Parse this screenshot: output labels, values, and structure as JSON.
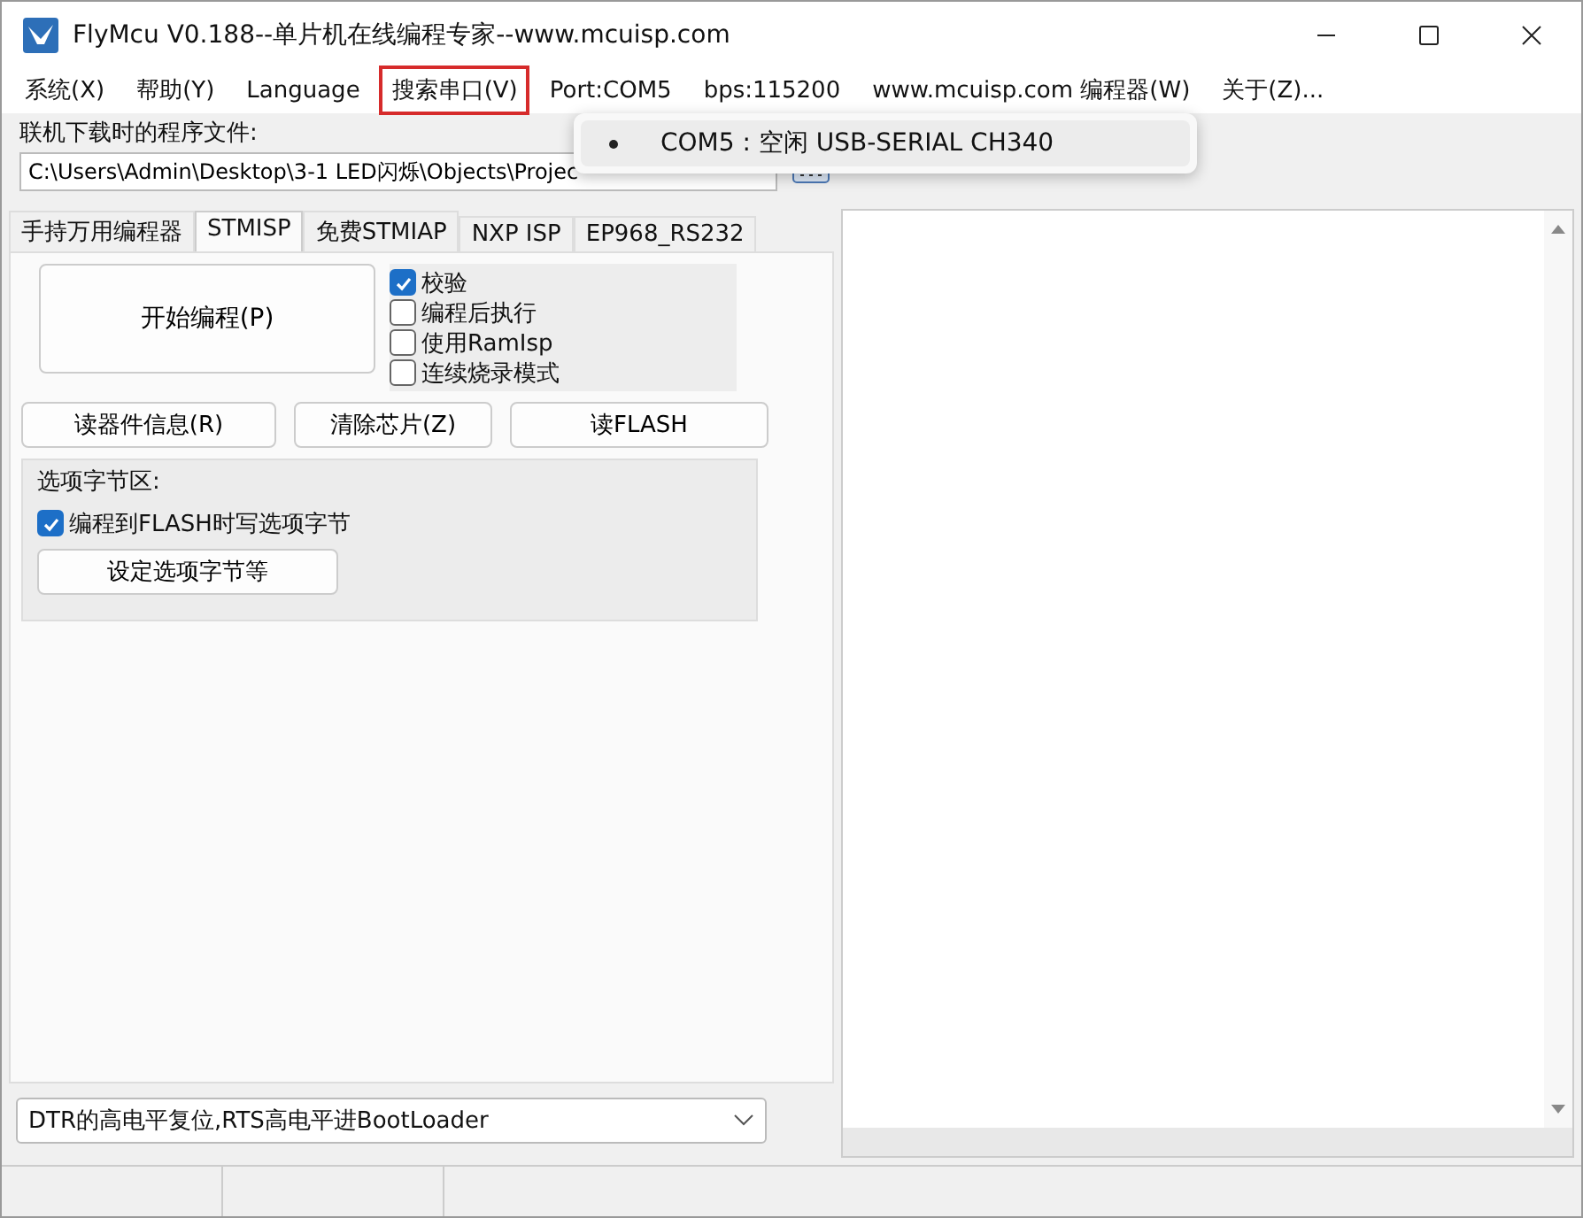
{
  "window": {
    "title": "FlyMcu V0.188--单片机在线编程专家--www.mcuisp.com"
  },
  "menu": [
    {
      "label": "系统(X)",
      "highlighted": false
    },
    {
      "label": "帮助(Y)",
      "highlighted": false
    },
    {
      "label": "Language",
      "highlighted": false
    },
    {
      "label": "搜索串口(V)",
      "highlighted": true
    },
    {
      "label": "Port:COM5",
      "highlighted": false
    },
    {
      "label": "bps:115200",
      "highlighted": false
    },
    {
      "label": "www.mcuisp.com 编程器(W)",
      "highlighted": false
    },
    {
      "label": "关于(Z)...",
      "highlighted": false
    }
  ],
  "port_popup": {
    "items": [
      {
        "label": "COM5 : 空闲 USB-SERIAL CH340",
        "selected": true
      }
    ]
  },
  "file": {
    "label": "联机下载时的程序文件:",
    "value": "C:\\Users\\Admin\\Desktop\\3-1 LED闪烁\\Objects\\Projec"
  },
  "tabs": [
    {
      "label": "手持万用编程器",
      "selected": false
    },
    {
      "label": "STMISP",
      "selected": true
    },
    {
      "label": "免费STMIAP",
      "selected": false
    },
    {
      "label": "NXP ISP",
      "selected": false
    },
    {
      "label": "EP968_RS232",
      "selected": false
    }
  ],
  "start_button": "开始编程(P)",
  "options": [
    {
      "label": "校验",
      "checked": true
    },
    {
      "label": "编程后执行",
      "checked": false
    },
    {
      "label": "使用RamIsp",
      "checked": false
    },
    {
      "label": "连续烧录模式",
      "checked": false
    }
  ],
  "buttons": [
    "读器件信息(R)",
    "清除芯片(Z)",
    "读FLASH"
  ],
  "option_bytes": {
    "title": "选项字节区:",
    "checkbox": {
      "label": "编程到FLASH时写选项字节",
      "checked": true
    },
    "button": "设定选项字节等"
  },
  "boot_mode": {
    "value": "DTR的高电平复位,RTS高电平进BootLoader"
  }
}
